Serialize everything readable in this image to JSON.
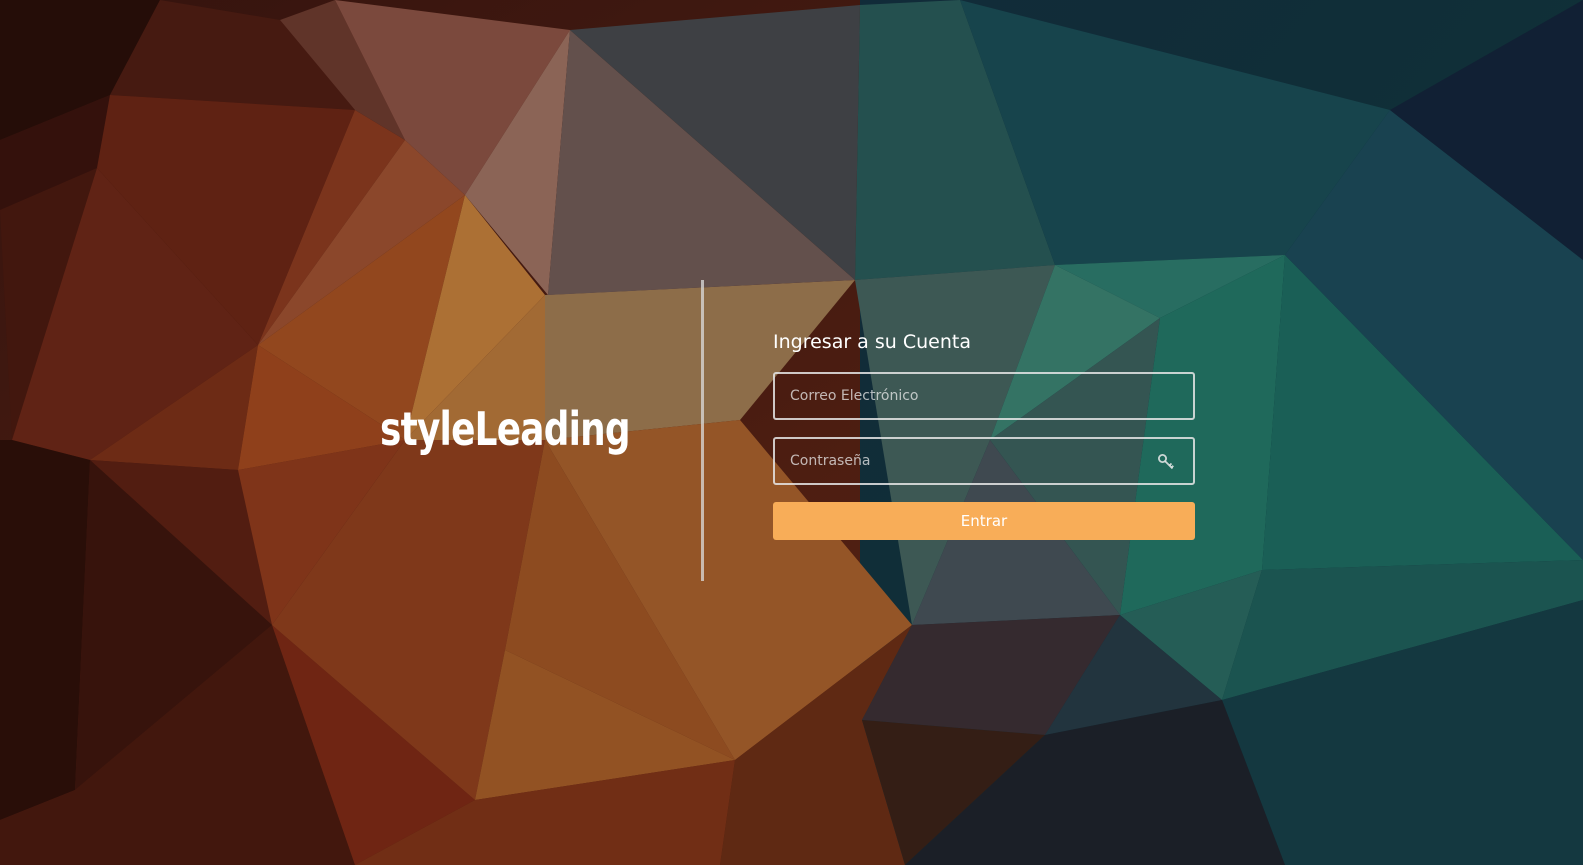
{
  "brand": {
    "name": "styleLeading"
  },
  "login": {
    "title": "Ingresar a su Cuenta",
    "email_placeholder": "Correo Electrónico",
    "email_value": "",
    "password_placeholder": "Contraseña",
    "password_value": "",
    "submit_label": "Entrar",
    "password_icon": "key-icon"
  },
  "colors": {
    "accent": "#f8ad58",
    "field_border": "#e6e6e6",
    "divider": "#dcdcdc",
    "text": "#ffffff"
  }
}
